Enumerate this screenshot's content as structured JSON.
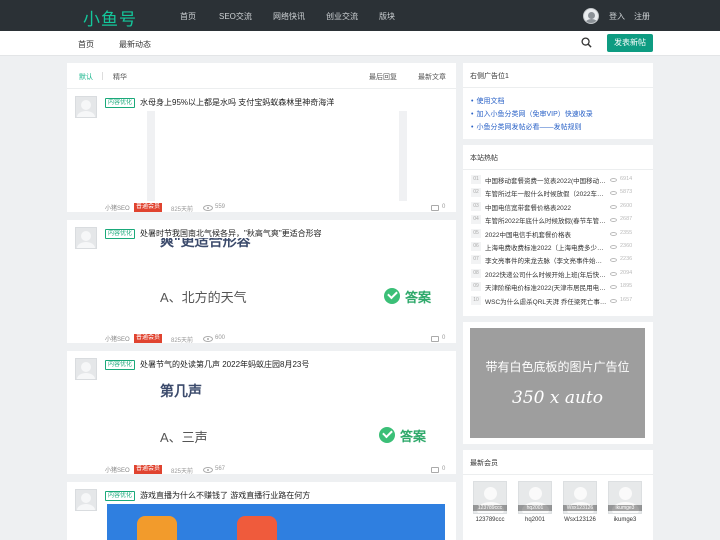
{
  "header": {
    "logo": "小鱼号",
    "nav": [
      "首页",
      "SEO交流",
      "网络快讯",
      "创业交流",
      "版块"
    ],
    "login": "登入",
    "register": "注册"
  },
  "subnav": {
    "items": [
      "首页",
      "最新动态"
    ],
    "post_button": "发表新帖"
  },
  "tabs": {
    "left": [
      "默认",
      "精华"
    ],
    "right": [
      "最后回复",
      "最新文章"
    ]
  },
  "posts": [
    {
      "badge": "内容优化",
      "title": "水母身上95%以上都是水吗 支付宝蚂蚁森林里神奇海洋",
      "author": "小猪SEO",
      "role": "普通会员",
      "time": "825天前",
      "views": "559",
      "comments": "0"
    },
    {
      "badge": "内容优化",
      "title": "处暑时节我国南北气候各异，\"秋高气爽\"更适合形容",
      "quiz_top": "爽\"更适合形容",
      "quiz_option": "A、北方的天气",
      "answer": "答案",
      "author": "小猪SEO",
      "role": "普通会员",
      "time": "825天前",
      "views": "600",
      "comments": "0"
    },
    {
      "badge": "内容优化",
      "title": "处暑节气的处读第几声 2022年蚂蚁庄园8月23号",
      "quiz_top": "第几声",
      "quiz_option": "A、三声",
      "answer": "答案",
      "author": "小猪SEO",
      "role": "普通会员",
      "time": "825天前",
      "views": "567",
      "comments": "0"
    },
    {
      "badge": "内容优化",
      "title": "游戏直播为什么不赚钱了 游戏直播行业路在何方"
    }
  ],
  "sidebar": {
    "ad_title": "右侧广告位1",
    "ad_links": [
      "使用文档",
      "加入小鱼分类网（免审VIP）快速收录",
      "小鱼分类网发帖必看——发帖规则"
    ],
    "hot_title": "本站热帖",
    "hot": [
      {
        "num": "01",
        "title": "中国移动套餐资费一览表2022(中国移动套餐资费)",
        "views": "6914"
      },
      {
        "num": "02",
        "title": "车管所过年一般什么时候放假（2022车管所春节放假时间）",
        "views": "5873"
      },
      {
        "num": "03",
        "title": "中国电信宽带套餐价格表2022",
        "views": "2600"
      },
      {
        "num": "04",
        "title": "车管所2022年底什么时候放假(春节车管所放假时间)",
        "views": "2687"
      },
      {
        "num": "05",
        "title": "2022中国电信手机套餐价格表",
        "views": "2355"
      },
      {
        "num": "06",
        "title": "上海电费收费标准2022（上海电费多少钱一度）",
        "views": "2360"
      },
      {
        "num": "07",
        "title": "李文亮事件的来龙去脉（李文亮事件始末）",
        "views": "2236"
      },
      {
        "num": "08",
        "title": "2022快递公司什么时候开始上班(年后快递几号恢复)",
        "views": "2094"
      },
      {
        "num": "09",
        "title": "天津阶梯电价标准2022(天津市居民用电收费标准)",
        "views": "1895"
      },
      {
        "num": "10",
        "title": "WSC为什么虐杀QRL天湃 乔任梁死亡事件真相",
        "views": "1657"
      }
    ],
    "ad_image_line1": "带有白色底板的图片广告位",
    "ad_image_line2": "350 x auto",
    "members_title": "最新会员",
    "members": [
      {
        "tag": "123789ccc",
        "name": "123789ccc"
      },
      {
        "tag": "hq2001",
        "name": "hq2001"
      },
      {
        "tag": "Wsx123126",
        "name": "Wsx123126"
      },
      {
        "tag": "ikumge3",
        "name": "ikumge3"
      }
    ]
  }
}
